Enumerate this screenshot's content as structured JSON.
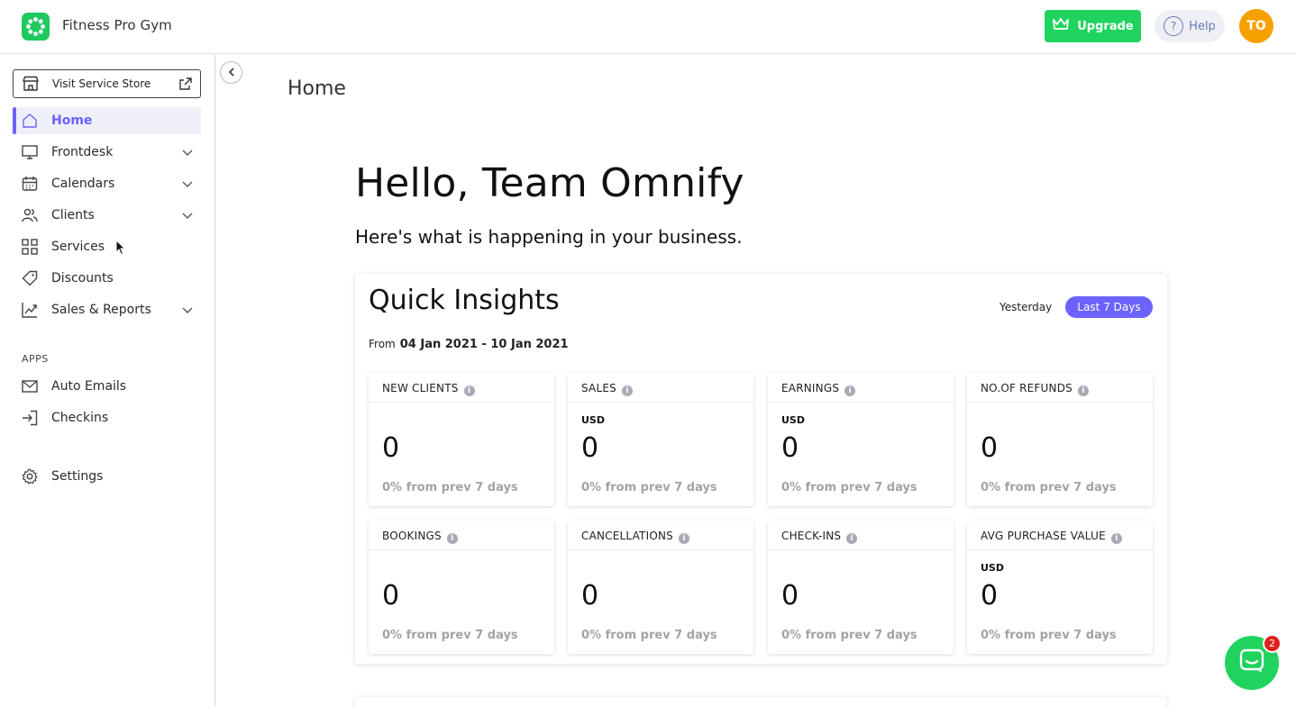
{
  "header": {
    "brand_name": "Fitness Pro Gym",
    "upgrade_label": "Upgrade",
    "help_label": "Help",
    "avatar_initials": "TO"
  },
  "sidebar": {
    "visit_store_label": "Visit Service Store",
    "items": [
      {
        "label": "Home",
        "icon": "home-icon",
        "active": true,
        "expandable": false
      },
      {
        "label": "Frontdesk",
        "icon": "monitor-icon",
        "active": false,
        "expandable": true
      },
      {
        "label": "Calendars",
        "icon": "calendar-icon",
        "active": false,
        "expandable": true
      },
      {
        "label": "Clients",
        "icon": "users-icon",
        "active": false,
        "expandable": true
      },
      {
        "label": "Services",
        "icon": "grid-icon",
        "active": false,
        "expandable": false
      },
      {
        "label": "Discounts",
        "icon": "tag-icon",
        "active": false,
        "expandable": false
      },
      {
        "label": "Sales & Reports",
        "icon": "chart-icon",
        "active": false,
        "expandable": true
      }
    ],
    "apps_section_label": "APPS",
    "apps": [
      {
        "label": "Auto Emails",
        "icon": "mail-icon"
      },
      {
        "label": "Checkins",
        "icon": "sign-in-icon"
      }
    ],
    "settings_label": "Settings"
  },
  "main": {
    "page_title": "Home",
    "greeting": "Hello, Team Omnify",
    "subtitle": "Here's what is happening in your business.",
    "insights": {
      "title": "Quick Insights",
      "period_yesterday": "Yesterday",
      "period_last7": "Last 7 Days",
      "range_prefix": "From",
      "range_value": "04 Jan 2021 - 10 Jan 2021",
      "metrics": [
        {
          "label": "NEW CLIENTS",
          "unit": "",
          "value": "0",
          "delta": "0% from prev 7 days"
        },
        {
          "label": "SALES",
          "unit": "USD",
          "value": "0",
          "delta": "0% from prev 7 days"
        },
        {
          "label": "EARNINGS",
          "unit": "USD",
          "value": "0",
          "delta": "0% from prev 7 days"
        },
        {
          "label": "NO.OF REFUNDS",
          "unit": "",
          "value": "0",
          "delta": "0% from prev 7 days"
        },
        {
          "label": "BOOKINGS",
          "unit": "",
          "value": "0",
          "delta": "0% from prev 7 days"
        },
        {
          "label": "CANCELLATIONS",
          "unit": "",
          "value": "0",
          "delta": "0% from prev 7 days"
        },
        {
          "label": "CHECK-INS",
          "unit": "",
          "value": "0",
          "delta": "0% from prev 7 days"
        },
        {
          "label": "AVG PURCHASE VALUE",
          "unit": "USD",
          "value": "0",
          "delta": "0% from prev 7 days"
        }
      ]
    }
  },
  "chat": {
    "badge_count": "2"
  },
  "colors": {
    "accent": "#6c63ff",
    "brand_green": "#1fd35e",
    "avatar_orange": "#f6a100",
    "badge_red": "#e0201b"
  }
}
